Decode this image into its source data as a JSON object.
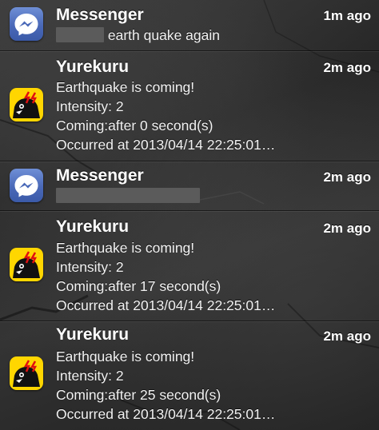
{
  "notifications": [
    {
      "app": "Messenger",
      "icon": "facebook-messenger-icon",
      "time": "1m ago",
      "message": "earth quake again",
      "sender_redacted": true
    },
    {
      "app": "Yurekuru",
      "icon": "yurekuru-app-icon",
      "time": "2m ago",
      "lines": [
        "Earthquake is coming!",
        "Intensity: 2",
        "Coming:after 0 second(s)",
        "Occurred at 2013/04/14 22:25:01…"
      ]
    },
    {
      "app": "Messenger",
      "icon": "facebook-messenger-icon",
      "time": "2m ago",
      "message": "",
      "message_redacted": true
    },
    {
      "app": "Yurekuru",
      "icon": "yurekuru-app-icon",
      "time": "2m ago",
      "lines": [
        "Earthquake is coming!",
        "Intensity: 2",
        "Coming:after 17 second(s)",
        "Occurred at 2013/04/14 22:25:01…"
      ]
    },
    {
      "app": "Yurekuru",
      "icon": "yurekuru-app-icon",
      "time": "2m ago",
      "lines": [
        "Earthquake is coming!",
        "Intensity: 2",
        "Coming:after 25 second(s)",
        "Occurred at 2013/04/14 22:25:01…"
      ]
    }
  ],
  "colors": {
    "messenger_blue": "#4a69b8",
    "yurekuru_yellow": "#ffd600",
    "redaction_gray": "#5b5b5b"
  }
}
